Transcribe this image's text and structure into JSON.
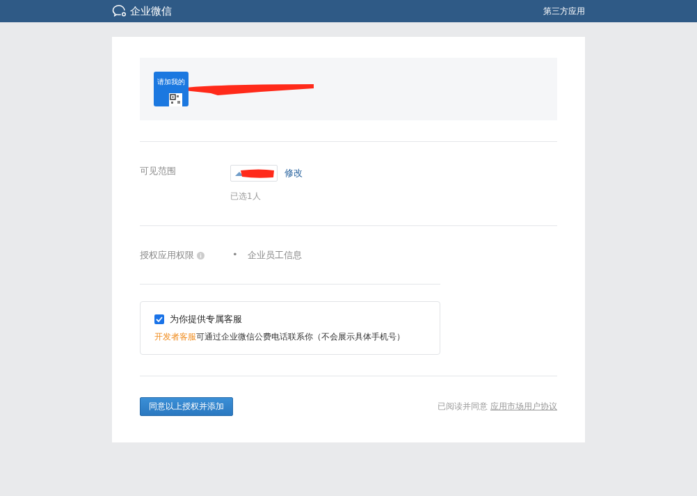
{
  "header": {
    "brand": "企业微信",
    "link": "第三方应用"
  },
  "app": {
    "icon_text": "请加我的"
  },
  "visibility": {
    "label": "可见范围",
    "edit_link": "修改",
    "selected_count": "已选1人"
  },
  "permissions": {
    "label": "授权应用权限",
    "items": [
      {
        "marker": "•",
        "text": "企业员工信息"
      }
    ]
  },
  "service": {
    "checked": true,
    "title": "为你提供专属客服",
    "highlight": "开发者客服",
    "description": "可通过企业微信公费电话联系你（不会展示具体手机号）"
  },
  "submit": "同意以上授权并添加",
  "agreement": {
    "text": "已阅读并同意",
    "link": "应用市场用户协议"
  }
}
